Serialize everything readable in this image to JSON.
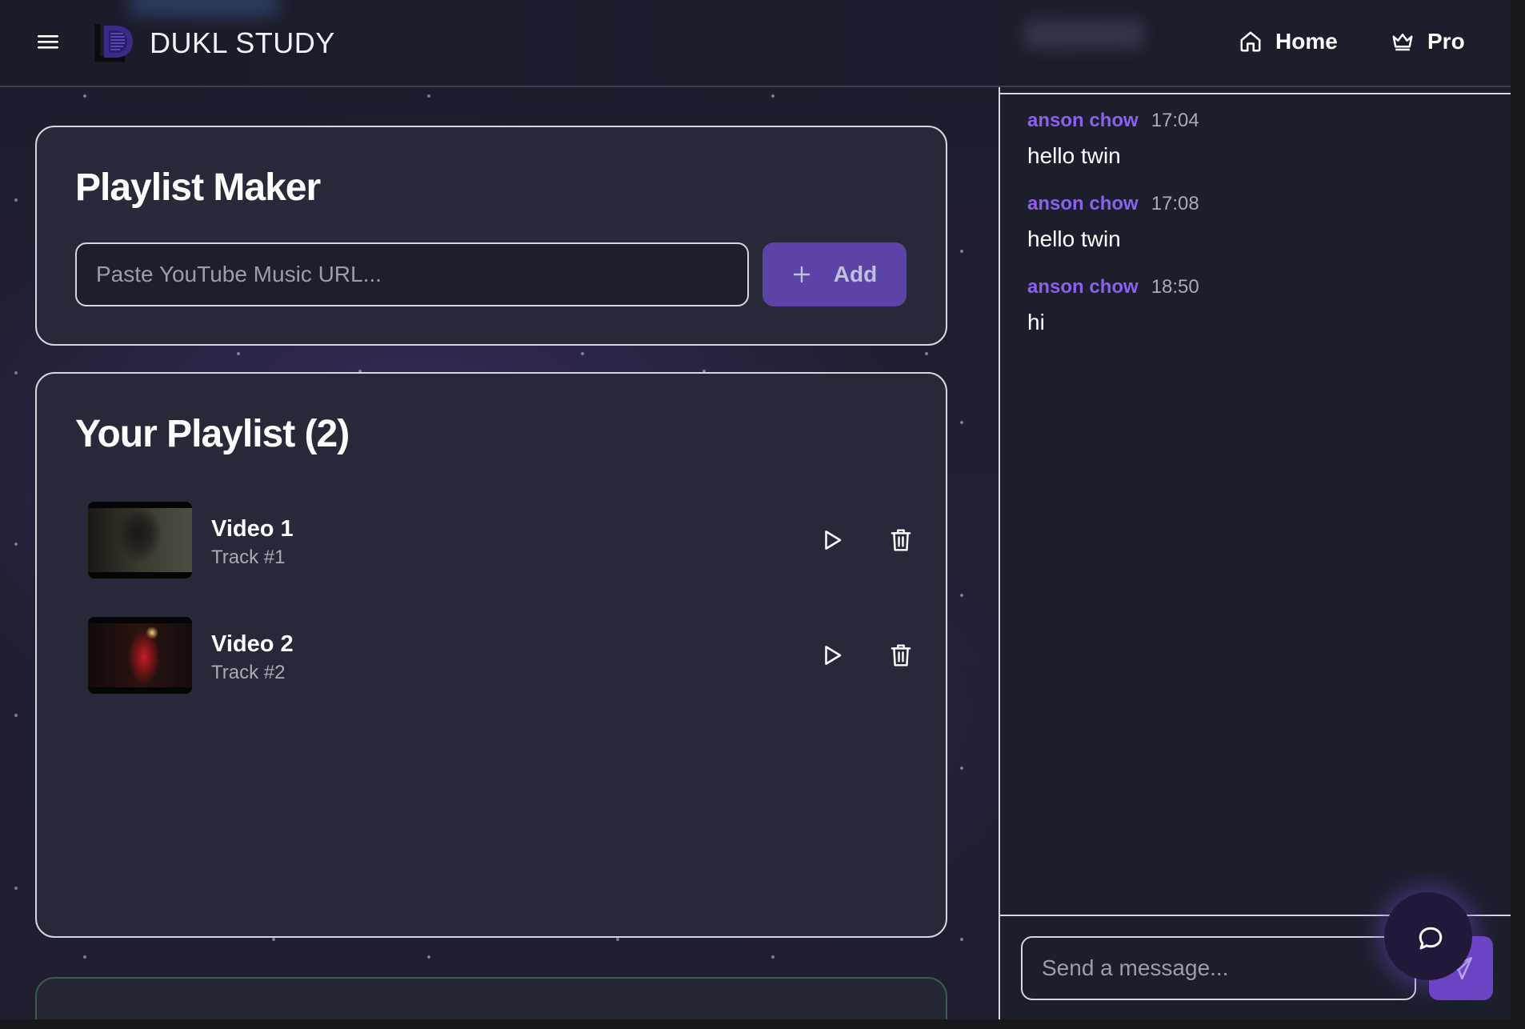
{
  "header": {
    "brand": "DUKL STUDY",
    "nav": [
      {
        "label": "Home",
        "icon": "home-icon"
      },
      {
        "label": "Pro",
        "icon": "crown-icon"
      }
    ]
  },
  "maker": {
    "title": "Playlist Maker",
    "url_placeholder": "Paste YouTube Music URL...",
    "url_value": "",
    "add_label": "Add"
  },
  "playlist": {
    "title": "Your Playlist (2)",
    "tracks": [
      {
        "title": "Video 1",
        "subtitle": "Track #1"
      },
      {
        "title": "Video 2",
        "subtitle": "Track #2"
      }
    ]
  },
  "chat": {
    "messages": [
      {
        "author": "anson chow",
        "time": "17:04",
        "text": "hello twin"
      },
      {
        "author": "anson chow",
        "time": "17:08",
        "text": "hello twin"
      },
      {
        "author": "anson chow",
        "time": "18:50",
        "text": "hi"
      }
    ],
    "input_placeholder": "Send a message..."
  },
  "colors": {
    "accent": "#5c43a6",
    "author": "#8d5ff0",
    "card_bg": "#262a38",
    "page_bg": "#1c1d28"
  }
}
